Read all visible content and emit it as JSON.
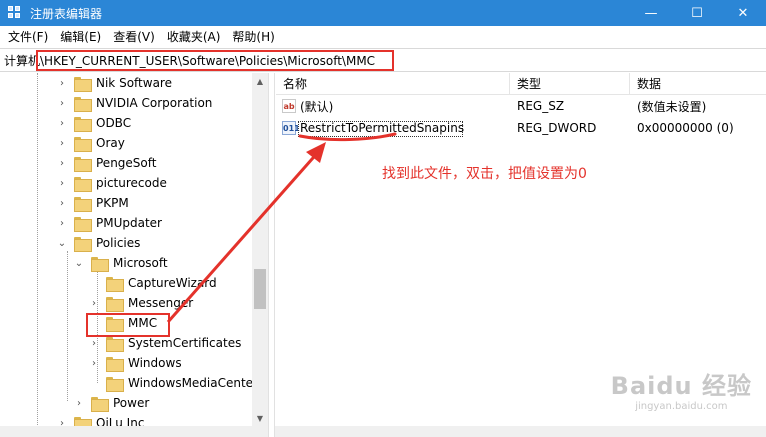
{
  "window": {
    "title": "注册表编辑器",
    "minimize": "—",
    "maximize": "☐",
    "close": "✕"
  },
  "menu": [
    "文件(F)",
    "编辑(E)",
    "查看(V)",
    "收藏夹(A)",
    "帮助(H)"
  ],
  "address": "计算机\\HKEY_CURRENT_USER\\Software\\Policies\\Microsoft\\MMC",
  "tree": [
    {
      "label": "Nik Software",
      "expander": "›"
    },
    {
      "label": "NVIDIA Corporation",
      "expander": "›"
    },
    {
      "label": "ODBC",
      "expander": "›"
    },
    {
      "label": "Oray",
      "expander": "›"
    },
    {
      "label": "PengeSoft",
      "expander": "›"
    },
    {
      "label": "picturecode",
      "expander": "›"
    },
    {
      "label": "PKPM",
      "expander": "›"
    },
    {
      "label": "PMUpdater",
      "expander": "›"
    },
    {
      "label": "Policies",
      "expander": "⌄"
    },
    {
      "label": "Microsoft",
      "expander": "⌄"
    },
    {
      "label": "CaptureWizard",
      "expander": ""
    },
    {
      "label": "Messenger",
      "expander": "›"
    },
    {
      "label": "MMC",
      "expander": ""
    },
    {
      "label": "SystemCertificates",
      "expander": "›"
    },
    {
      "label": "Windows",
      "expander": "›"
    },
    {
      "label": "WindowsMediaCenter",
      "expander": ""
    },
    {
      "label": "Power",
      "expander": "›"
    },
    {
      "label": "QiLu Inc",
      "expander": "›"
    }
  ],
  "columns": {
    "name": "名称",
    "type": "类型",
    "data": "数据"
  },
  "values": [
    {
      "icon": "ab",
      "name": "(默认)",
      "type": "REG_SZ",
      "data": "(数值未设置)"
    },
    {
      "icon": "011",
      "name": "RestrictToPermittedSnapins",
      "type": "REG_DWORD",
      "data": "0x00000000 (0)"
    }
  ],
  "annotation": "找到此文件，双击，把值设置为0",
  "watermark": {
    "logo": "Baidu 经验",
    "url": "jingyan.baidu.com"
  },
  "colors": {
    "titlebar": "#2b86d6",
    "annotation": "#e4322b",
    "folder": "#f3d27a"
  }
}
